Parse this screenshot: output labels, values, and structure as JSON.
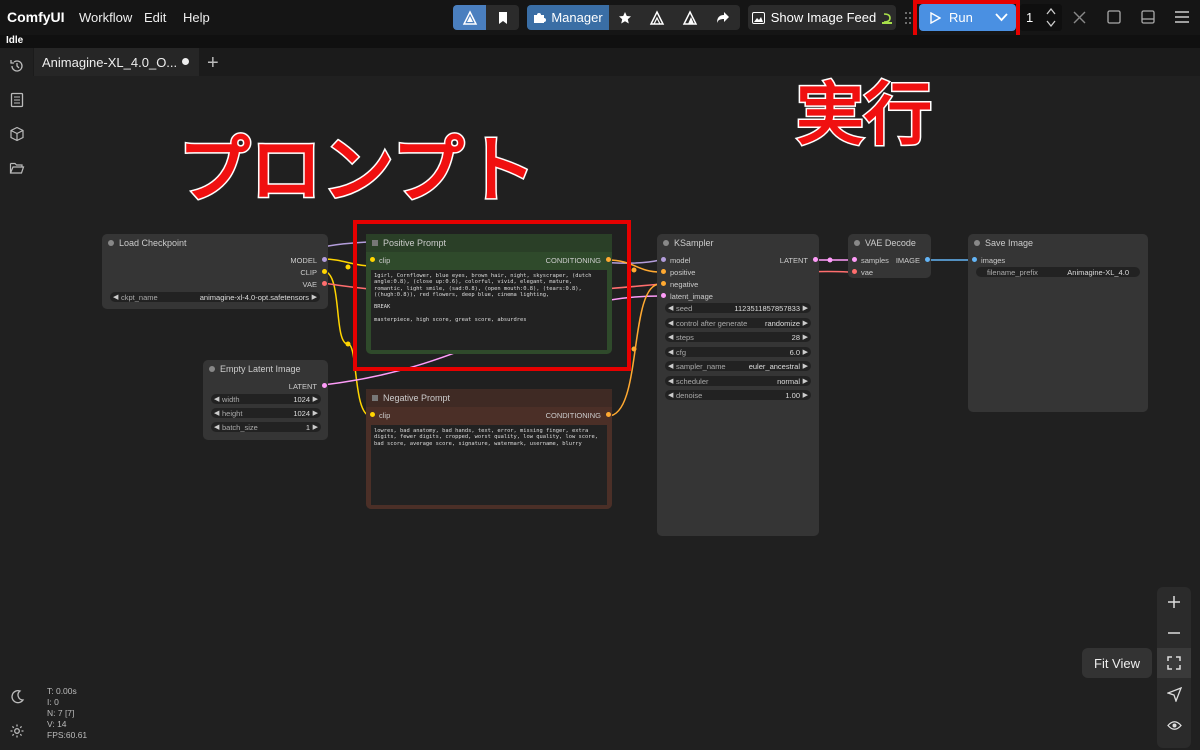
{
  "app": {
    "name": "ComfyUI"
  },
  "menu": {
    "workflow": "Workflow",
    "edit": "Edit",
    "help": "Help"
  },
  "toolbar": {
    "manager_label": "Manager",
    "show_image_feed_label": "Show Image Feed",
    "run_label": "Run",
    "queue_count": "1"
  },
  "status": {
    "text": "Idle"
  },
  "tabs": [
    {
      "label": "Animagine-XL_4.0_O..."
    }
  ],
  "overlays": {
    "prompt": "プロンプト",
    "run": "実行"
  },
  "nodes": {
    "load_checkpoint": {
      "title": "Load Checkpoint",
      "outputs": [
        "MODEL",
        "CLIP",
        "VAE"
      ],
      "widget_label": "ckpt_name",
      "widget_value": "animagine-xl-4.0-opt.safetensors"
    },
    "empty_latent": {
      "title": "Empty Latent Image",
      "output": "LATENT",
      "widgets": [
        {
          "label": "width",
          "value": "1024"
        },
        {
          "label": "height",
          "value": "1024"
        },
        {
          "label": "batch_size",
          "value": "1"
        }
      ]
    },
    "positive": {
      "title": "Positive Prompt",
      "input": "clip",
      "output": "CONDITIONING",
      "text": "1girl, Cornflower, blue eyes, brown hair, night, skyscraper, (dutch angle:0.8), (close up:0.6), colorful, vivid, elegant, mature, romantic, light smile, (sad:0.8), (open mouth:0.8), (tears:0.8), ((hugh:0.8)), red flowers, deep blue, cinema lighting,\n\nBREAK\n\nmasterpiece, high score, great score, absurdres"
    },
    "negative": {
      "title": "Negative Prompt",
      "input": "clip",
      "output": "CONDITIONING",
      "text": "lowres, bad anatomy, bad hands, text, error, missing finger, extra digits, fewer digits, cropped, worst quality, low quality, low score, bad score, average score, signature, watermark, username, blurry"
    },
    "ksampler": {
      "title": "KSampler",
      "inputs": [
        "model",
        "positive",
        "negative",
        "latent_image"
      ],
      "output": "LATENT",
      "widgets": [
        {
          "label": "seed",
          "value": "1123511857857833"
        },
        {
          "label": "control after generate",
          "value": "randomize"
        },
        {
          "label": "steps",
          "value": "28"
        },
        {
          "label": "cfg",
          "value": "6.0"
        },
        {
          "label": "sampler_name",
          "value": "euler_ancestral"
        },
        {
          "label": "scheduler",
          "value": "normal"
        },
        {
          "label": "denoise",
          "value": "1.00"
        }
      ]
    },
    "vae_decode": {
      "title": "VAE Decode",
      "inputs": [
        "samples",
        "vae"
      ],
      "output": "IMAGE"
    },
    "save_image": {
      "title": "Save Image",
      "input": "images",
      "widget_label": "filename_prefix",
      "widget_value": "Animagine-XL_4.0"
    }
  },
  "stats": [
    "T: 0.00s",
    "I: 0",
    "N: 7 [7]",
    "V: 14",
    "FPS:60.61"
  ],
  "tooltip": "Fit View",
  "colors": {
    "model": "#b39ddb",
    "clip": "#ffd500",
    "vae": "#ff6e6e",
    "latent": "#ff9cf9",
    "conditioning": "#ffa931",
    "image": "#64b5f6",
    "positive_node": "#2a4a2a",
    "negative_node": "#4a2e28",
    "run_button": "#4a90e2",
    "highlight": "#e60000"
  }
}
